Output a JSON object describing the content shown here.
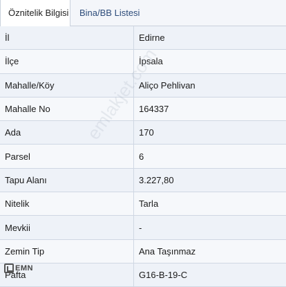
{
  "tabs": {
    "active": "Öznitelik Bilgisi",
    "inactive": "Bina/BB Listesi"
  },
  "rows": [
    {
      "key": "İl",
      "value": "Edirne"
    },
    {
      "key": "İlçe",
      "value": "İpsala"
    },
    {
      "key": "Mahalle/Köy",
      "value": "Aliço Pehlivan"
    },
    {
      "key": "Mahalle No",
      "value": "164337"
    },
    {
      "key": "Ada",
      "value": "170"
    },
    {
      "key": "Parsel",
      "value": "6"
    },
    {
      "key": "Tapu Alanı",
      "value": "3.227,80"
    },
    {
      "key": "Nitelik",
      "value": "Tarla"
    },
    {
      "key": "Mevkii",
      "value": "-"
    },
    {
      "key": "Zemin Tip",
      "value": "Ana Taşınmaz"
    },
    {
      "key": "Pafta",
      "value": "G16-B-19-C"
    }
  ],
  "watermark": "emlakjet.com",
  "logo": {
    "text": "EMN"
  }
}
